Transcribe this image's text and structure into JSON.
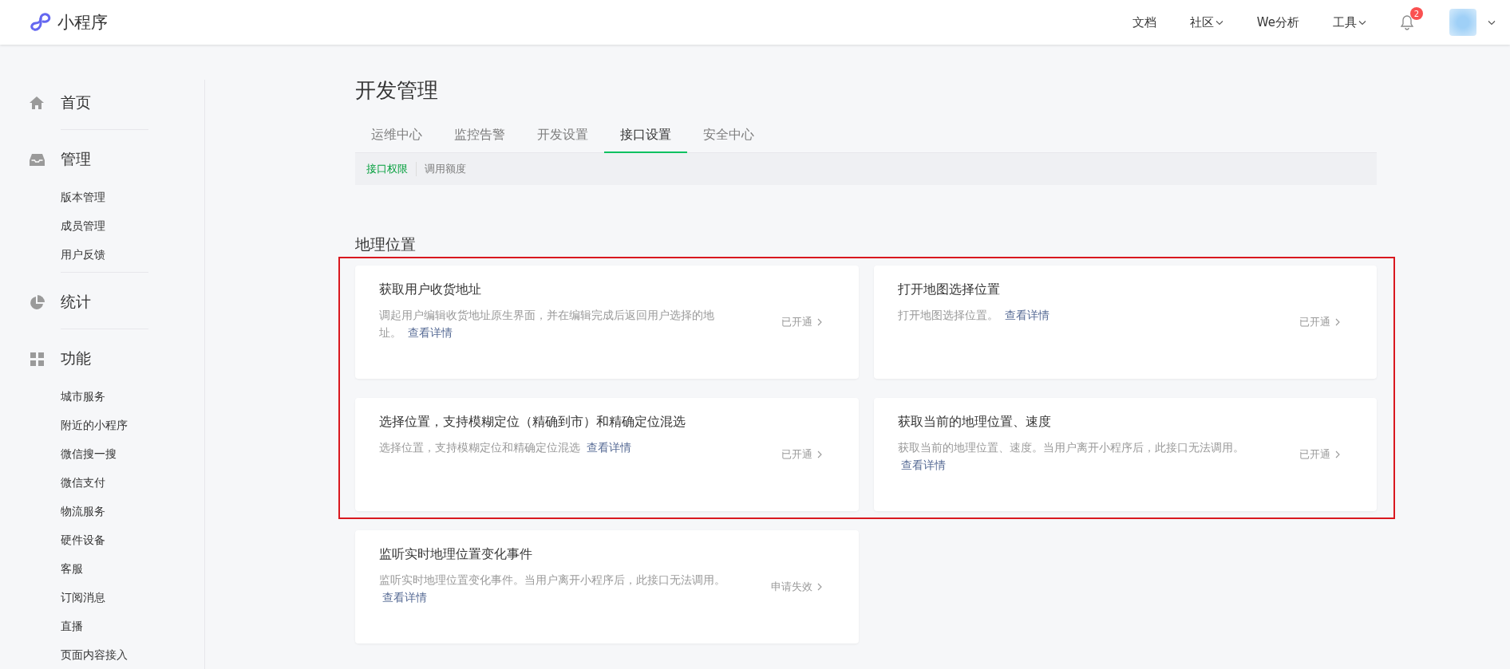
{
  "header": {
    "logo_text": "小程序",
    "nav": [
      {
        "label": "文档",
        "dropdown": false
      },
      {
        "label": "社区",
        "dropdown": true
      },
      {
        "label": "We分析",
        "dropdown": false
      },
      {
        "label": "工具",
        "dropdown": true
      }
    ],
    "notifications": {
      "count": "2"
    }
  },
  "sidebar": {
    "groups": [
      {
        "label": "首页"
      },
      {
        "label": "管理",
        "items": [
          "版本管理",
          "成员管理",
          "用户反馈"
        ]
      },
      {
        "label": "统计"
      },
      {
        "label": "功能",
        "items": [
          "城市服务",
          "附近的小程序",
          "微信搜一搜",
          "微信支付",
          "物流服务",
          "硬件设备",
          "客服",
          "订阅消息",
          "直播",
          "页面内容接入"
        ]
      }
    ]
  },
  "page": {
    "title": "开发管理",
    "tabs": [
      {
        "label": "运维中心",
        "selected": false
      },
      {
        "label": "监控告警",
        "selected": false
      },
      {
        "label": "开发设置",
        "selected": false
      },
      {
        "label": "接口设置",
        "selected": true
      },
      {
        "label": "安全中心",
        "selected": false
      }
    ],
    "subtabs": [
      {
        "label": "接口权限",
        "selected": true
      },
      {
        "label": "调用额度",
        "selected": false
      }
    ],
    "section_title": "地理位置",
    "highlighted_cards": [
      {
        "title": "获取用户收货地址",
        "description": "调起用户编辑收货地址原生界面，并在编辑完成后返回用户选择的地址。",
        "link": "查看详情",
        "status": "已开通"
      },
      {
        "title": "打开地图选择位置",
        "description": "打开地图选择位置。",
        "link": "查看详情",
        "status": "已开通"
      },
      {
        "title": "选择位置，支持模糊定位（精确到市）和精确定位混选",
        "description": "选择位置，支持模糊定位和精确定位混选",
        "link": "查看详情",
        "status": "已开通"
      },
      {
        "title": "获取当前的地理位置、速度",
        "description": "获取当前的地理位置、速度。当用户离开小程序后，此接口无法调用。",
        "link": "查看详情",
        "status": "已开通"
      }
    ],
    "cards": [
      {
        "title": "监听实时地理位置变化事件",
        "description": "监听实时地理位置变化事件。当用户离开小程序后，此接口无法调用。",
        "link": "查看详情",
        "status": "申请失效"
      }
    ]
  }
}
